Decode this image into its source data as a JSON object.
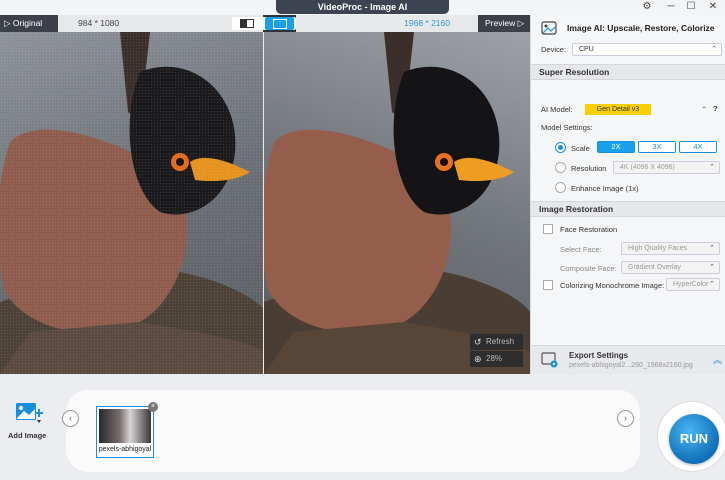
{
  "window": {
    "title": "VideoProc - Image AI",
    "settings_icon": "gear-icon",
    "minimize": "─",
    "maximize": "☐",
    "close": "✕",
    "gear": "⚙"
  },
  "compare_bar": {
    "original_label": "▷ Original",
    "original_dims": "984 * 1080",
    "output_dims": "1968 * 2160",
    "preview_label": "Preview ▷"
  },
  "canvas": {
    "refresh_label": "Refresh",
    "zoom_label": "28%",
    "refresh_icon": "↺",
    "zoom_icon": "⊕"
  },
  "panel": {
    "title": "Image AI: Upscale, Restore, Colorize",
    "device_label": "Device:",
    "device_value": "CPU",
    "super_resolution": {
      "section_title": "Super Resolution",
      "model_label": "AI Model:",
      "model_value": "Gen Detail v3",
      "help": "?",
      "settings_label": "Model Settings:",
      "scale_label": "Scale",
      "scale_options": [
        "2X",
        "3X",
        "4X"
      ],
      "scale_selected": "2X",
      "resolution_label": "Resolution",
      "resolution_value": "4K (4096 X 4096)",
      "enhance_label": "Enhance Image (1x)"
    },
    "restoration": {
      "section_title": "Image Restoration",
      "face_label": "Face Restoration",
      "select_face_label": "Select Face:",
      "select_face_value": "High Quality Faces",
      "composite_label": "Composite Face:",
      "composite_value": "Gradient Overlay",
      "colorize_label": "Colorizing Monochrome Image:",
      "colorize_value": "HyperColor"
    },
    "export": {
      "title": "Export Settings",
      "filename": "pexels-abhigoyal2...260_1968x2160.jpg"
    }
  },
  "bottom": {
    "add_image_label": "Add Image",
    "thumb_caption": "pexels-abhigoyal",
    "nav_left": "‹",
    "nav_right": "›",
    "run_label": "RUN",
    "remove": "×"
  },
  "colors": {
    "accent": "#1aa0e8",
    "model_chip": "#f7d000",
    "titlebar_dark": "#3d4350"
  }
}
